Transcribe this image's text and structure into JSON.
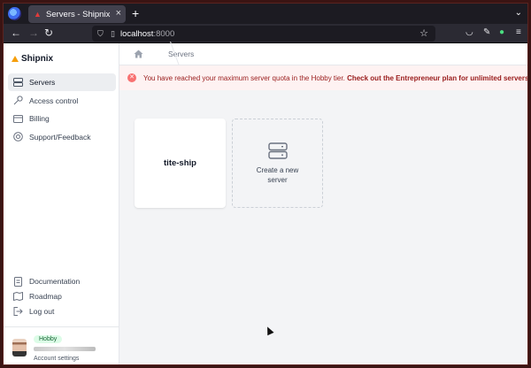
{
  "browser": {
    "tab_title": "Servers - Shipnix",
    "url_host": "localhost",
    "url_port": ":8000"
  },
  "app": {
    "brand": "Shipnix",
    "nav": [
      {
        "label": "Servers",
        "icon": "server-icon"
      },
      {
        "label": "Access control",
        "icon": "key-icon"
      },
      {
        "label": "Billing",
        "icon": "credit-card-icon"
      },
      {
        "label": "Support/Feedback",
        "icon": "lifebuoy-icon"
      }
    ],
    "nav_bottom": [
      {
        "label": "Documentation",
        "icon": "document-icon"
      },
      {
        "label": "Roadmap",
        "icon": "map-icon"
      },
      {
        "label": "Log out",
        "icon": "logout-icon"
      }
    ],
    "user": {
      "plan": "Hobby",
      "account_settings": "Account settings"
    }
  },
  "main": {
    "breadcrumb": "Servers",
    "alert": {
      "text": "You have reached your maximum server quota in the Hobby tier.",
      "link": "Check out the Entrepreneur plan for unlimited servers"
    },
    "servers": [
      {
        "name": "tite-ship"
      }
    ],
    "create_label": "Create a new server"
  },
  "colors": {
    "accent": "#f59e0b",
    "alert_text": "#991b1b",
    "alert_bg": "#fef2f2",
    "badge_bg": "#dcfce7"
  }
}
